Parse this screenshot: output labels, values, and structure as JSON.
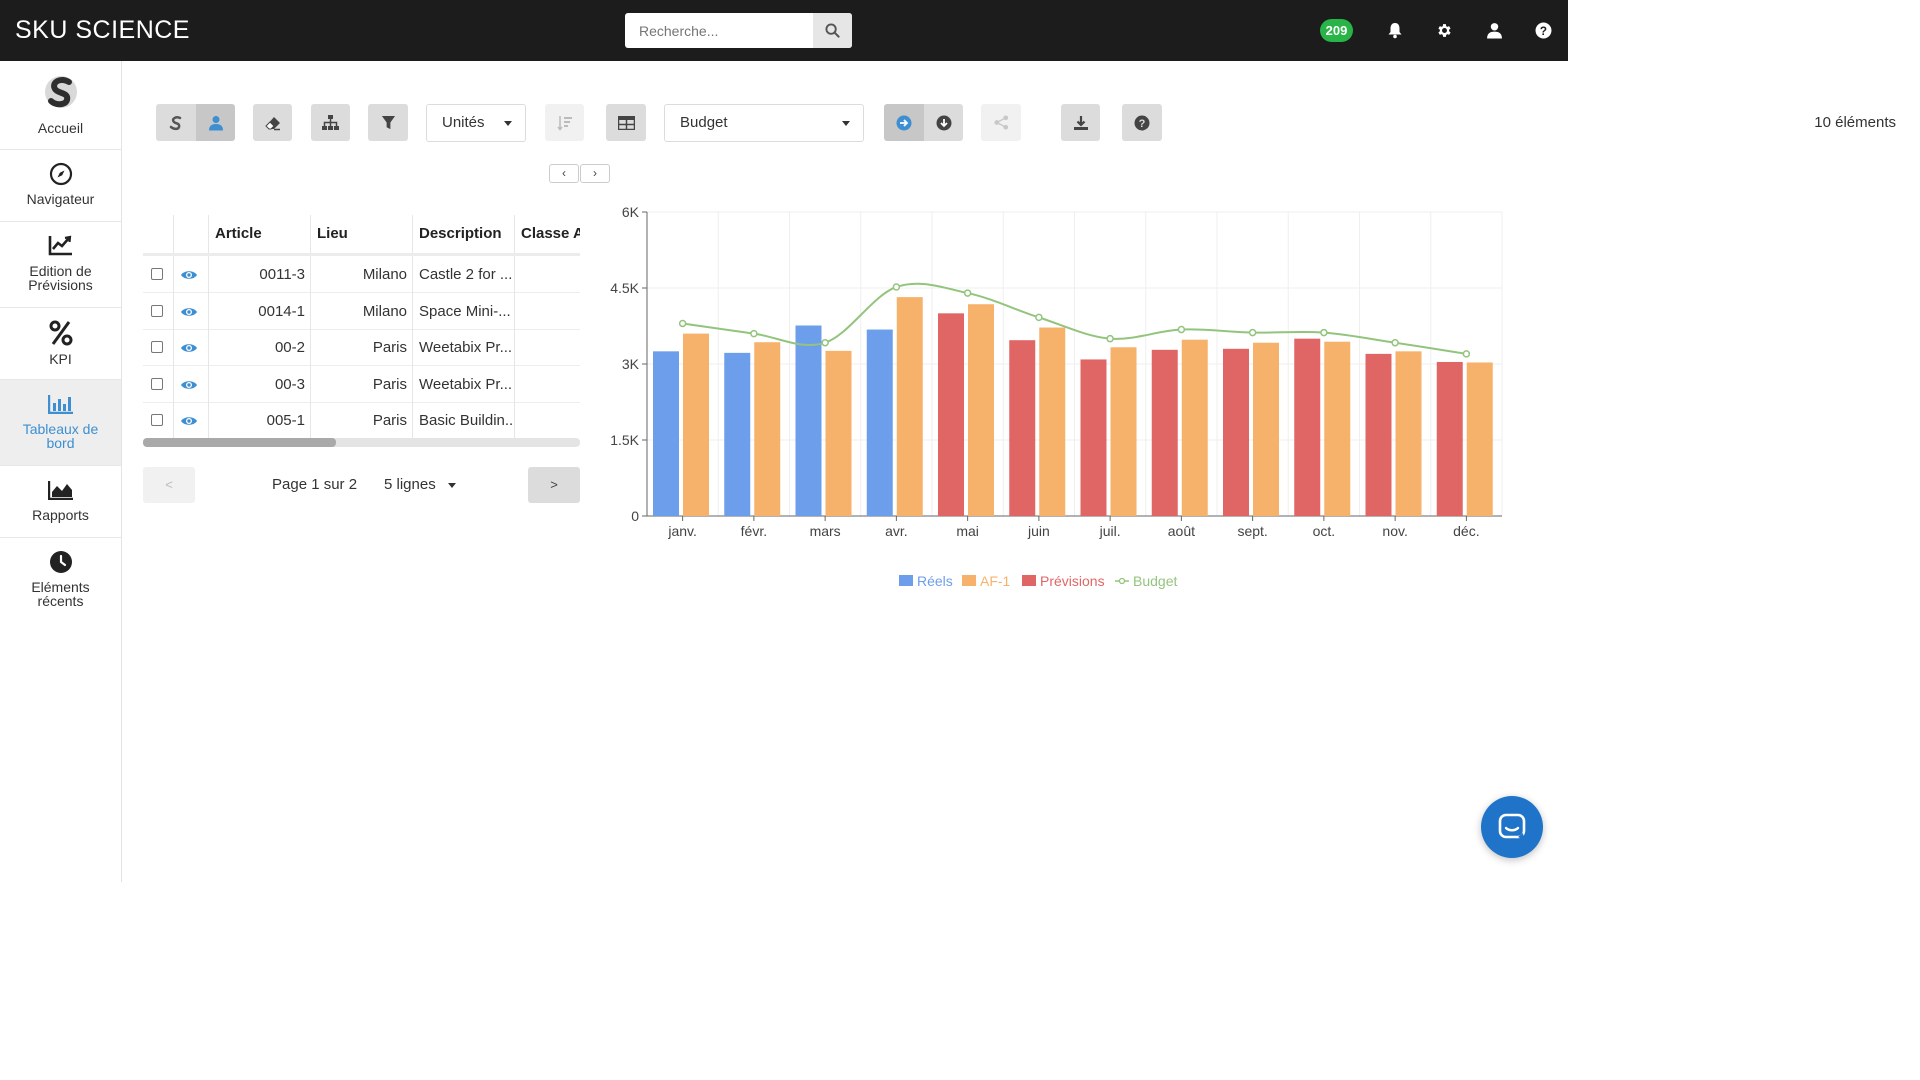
{
  "app": {
    "brand": "SKU SCIENCE"
  },
  "search": {
    "placeholder": "Recherche..."
  },
  "header": {
    "notification_count": "209"
  },
  "sidebar": {
    "items": [
      {
        "label": "Accueil"
      },
      {
        "label": "Navigateur"
      },
      {
        "label": "Edition de Prévisions"
      },
      {
        "label": "KPI"
      },
      {
        "label": "Tableaux de bord"
      },
      {
        "label": "Rapports"
      },
      {
        "label": "Eléments récents"
      }
    ]
  },
  "toolbar": {
    "unit_select": "Unités",
    "compare_select": "Budget",
    "element_count": "10 éléments"
  },
  "table": {
    "columns": [
      "Article",
      "Lieu",
      "Description",
      "Classe AB"
    ],
    "rows": [
      {
        "article": "0011-3",
        "lieu": "Milano",
        "description": "Castle 2 for ..."
      },
      {
        "article": "0014-1",
        "lieu": "Milano",
        "description": "Space Mini-..."
      },
      {
        "article": "00-2",
        "lieu": "Paris",
        "description": "Weetabix Pr..."
      },
      {
        "article": "00-3",
        "lieu": "Paris",
        "description": "Weetabix Pr..."
      },
      {
        "article": "005-1",
        "lieu": "Paris",
        "description": "Basic Buildin..."
      }
    ]
  },
  "pagination": {
    "prev": "<",
    "next": ">",
    "page_info": "Page 1 sur 2",
    "rows_per_page": "5 lignes"
  },
  "colors": {
    "reels": "#6d9eeb",
    "af1": "#f6b26b",
    "previsions": "#e06666",
    "budget": "#93c47d",
    "accent": "#3d8fd1"
  },
  "chart_data": {
    "type": "bar",
    "categories": [
      "janv.",
      "févr.",
      "mars",
      "avr.",
      "mai",
      "juin",
      "juil.",
      "août",
      "sept.",
      "oct.",
      "nov.",
      "déc."
    ],
    "ylim": [
      0,
      6000
    ],
    "yticks": [
      0,
      1500,
      3000,
      4500,
      6000
    ],
    "ytick_labels": [
      "0",
      "1.5K",
      "3K",
      "4.5K",
      "6K"
    ],
    "grid": true,
    "legend": "bottom-center",
    "series": [
      {
        "name": "Réels",
        "kind": "bar",
        "values": [
          3250,
          3220,
          3760,
          3680,
          null,
          null,
          null,
          null,
          null,
          null,
          null,
          null
        ]
      },
      {
        "name": "AF-1",
        "kind": "bar",
        "values": [
          3600,
          3430,
          3260,
          4320,
          4180,
          3720,
          3330,
          3480,
          3420,
          3440,
          3250,
          3030
        ]
      },
      {
        "name": "Prévisions",
        "kind": "bar",
        "values": [
          null,
          null,
          null,
          null,
          4000,
          3470,
          3090,
          3280,
          3300,
          3500,
          3200,
          3040
        ]
      },
      {
        "name": "Budget",
        "kind": "line",
        "values": [
          3800,
          3600,
          3420,
          4520,
          4400,
          3920,
          3500,
          3680,
          3620,
          3620,
          3420,
          3200
        ]
      }
    ]
  }
}
